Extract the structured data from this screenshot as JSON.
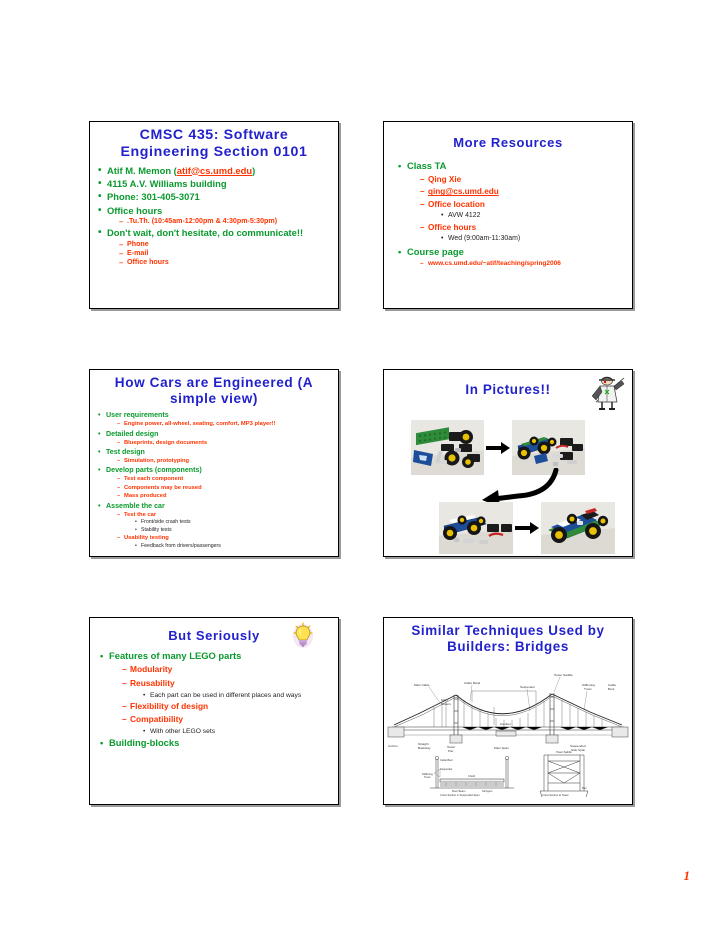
{
  "page": {
    "page_number": "1",
    "accent_title_color": "#2222cc",
    "level1_color": "#0b9a2e",
    "level2_color": "#ff3300",
    "level3_color": "#222222"
  },
  "slides": [
    {
      "id": "slide1",
      "title": "CMSC 435: Software Engineering Section 0101",
      "title_line1": "CMSC 435: Software",
      "title_line2": "Engineering Section 0101",
      "bullets": [
        {
          "text": "Atif M. Memon (",
          "link": "atif@cs.umd.edu",
          "text_after": ")"
        },
        {
          "text": "4115 A.V. Williams building"
        },
        {
          "text": "Phone: 301-405-3071"
        },
        {
          "text": "Office hours",
          "sub": [
            {
              "text": ".Tu.Th. (10:45am-12:00pm & 4:30pm-5:30pm)"
            }
          ]
        },
        {
          "text": "Don't wait, don't hesitate, do communicate!!",
          "sub": [
            {
              "text": "Phone"
            },
            {
              "text": "E-mail"
            },
            {
              "text": "Office hours"
            }
          ]
        }
      ]
    },
    {
      "id": "slide2",
      "title": "More Resources",
      "bullets": [
        {
          "text": "Class TA",
          "sub": [
            {
              "text": "Qing Xie"
            },
            {
              "text": "qing@cs.umd.edu",
              "underline": true
            },
            {
              "text": "Office location",
              "sub2": [
                {
                  "text": "AVW 4122"
                }
              ]
            },
            {
              "text": "Office hours",
              "sub2": [
                {
                  "text": "Wed (9:00am-11:30am)"
                }
              ]
            }
          ]
        },
        {
          "text": "Course page",
          "sub": [
            {
              "text": "www.cs.umd.edu/~atif/teaching/spring2006",
              "tiny": true
            }
          ]
        }
      ]
    },
    {
      "id": "slide3",
      "title": "How Cars are Engineered (A simple view)",
      "title_line1": "How Cars are Engineered (A",
      "title_line2": "simple view)",
      "bullets": [
        {
          "text": "User requirements",
          "sub": [
            {
              "text": "Engine power, all-wheel, seating, comfort, MP3 player!!"
            }
          ]
        },
        {
          "text": "Detailed design",
          "sub": [
            {
              "text": "Blueprints, design documents"
            }
          ]
        },
        {
          "text": "Test design",
          "sub": [
            {
              "text": "Simulation, prototyping"
            }
          ]
        },
        {
          "text": "Develop parts (components)",
          "sub": [
            {
              "text": "Test each component"
            },
            {
              "text": "Components may be reused"
            },
            {
              "text": "Mass produced"
            }
          ]
        },
        {
          "text": "Assemble the car",
          "sub": [
            {
              "text": "Test the car",
              "sub2": [
                {
                  "text": "Front/side crash tests"
                },
                {
                  "text": "Stability tests"
                }
              ]
            },
            {
              "text": "Usability testing",
              "sub2": [
                {
                  "text": "Feedback from drivers/passengers"
                }
              ]
            }
          ]
        }
      ]
    },
    {
      "id": "slide4",
      "title": "In Pictures!!",
      "clipart": "pirate-character-clipart",
      "photos": [
        {
          "name": "lego-parts-photo",
          "caption": "LEGO parts laid out"
        },
        {
          "name": "lego-chassis-photo",
          "caption": "LEGO chassis assembled"
        },
        {
          "name": "lego-partial-car-photo",
          "caption": "Partially assembled LEGO car"
        },
        {
          "name": "lego-finished-car-photo",
          "caption": "Finished LEGO car"
        }
      ]
    },
    {
      "id": "slide5",
      "title": "But Seriously",
      "clipart": "lightbulb-icon",
      "bullets": [
        {
          "text": "Features of many LEGO parts",
          "sub": [
            {
              "text": "Modularity"
            },
            {
              "text": "Reusability",
              "sub2": [
                {
                  "text": "Each part can be used in different places and ways"
                }
              ]
            },
            {
              "text": "Flexibility of design"
            },
            {
              "text": "Compatibility",
              "sub2": [
                {
                  "text": "With other LEGO sets"
                }
              ]
            }
          ]
        },
        {
          "text": "Building-blocks"
        }
      ]
    },
    {
      "id": "slide6",
      "title": "Similar Techniques Used by Builders: Bridges",
      "title_line1": "Similar Techniques Used by",
      "title_line2": "Builders: Bridges",
      "diagram": {
        "name": "suspension-bridge-diagram",
        "labels_top": [
          "Main Cable",
          "Cable Band",
          "Tower Saddle",
          "Suspender",
          "Stiffening Truss",
          "Cable Bent"
        ],
        "labels_mid": [
          "Main Towers",
          "Camber"
        ],
        "labels_bottom": [
          "Anchor",
          "Straight Backstay",
          "Tower Pier",
          "Main Span",
          "Suspended Side Span"
        ],
        "sub_caption_left": "Cross Section in Suspended Span",
        "sub_caption_right": "Cross Section at Tower",
        "sub_labels_left": [
          "Cable Bent",
          "Suspender",
          "Stiffening Truss",
          "Chord",
          "Floor Beam",
          "Stringers"
        ],
        "sub_labels_right": [
          "Tower Saddle",
          "Pier"
        ]
      }
    }
  ]
}
